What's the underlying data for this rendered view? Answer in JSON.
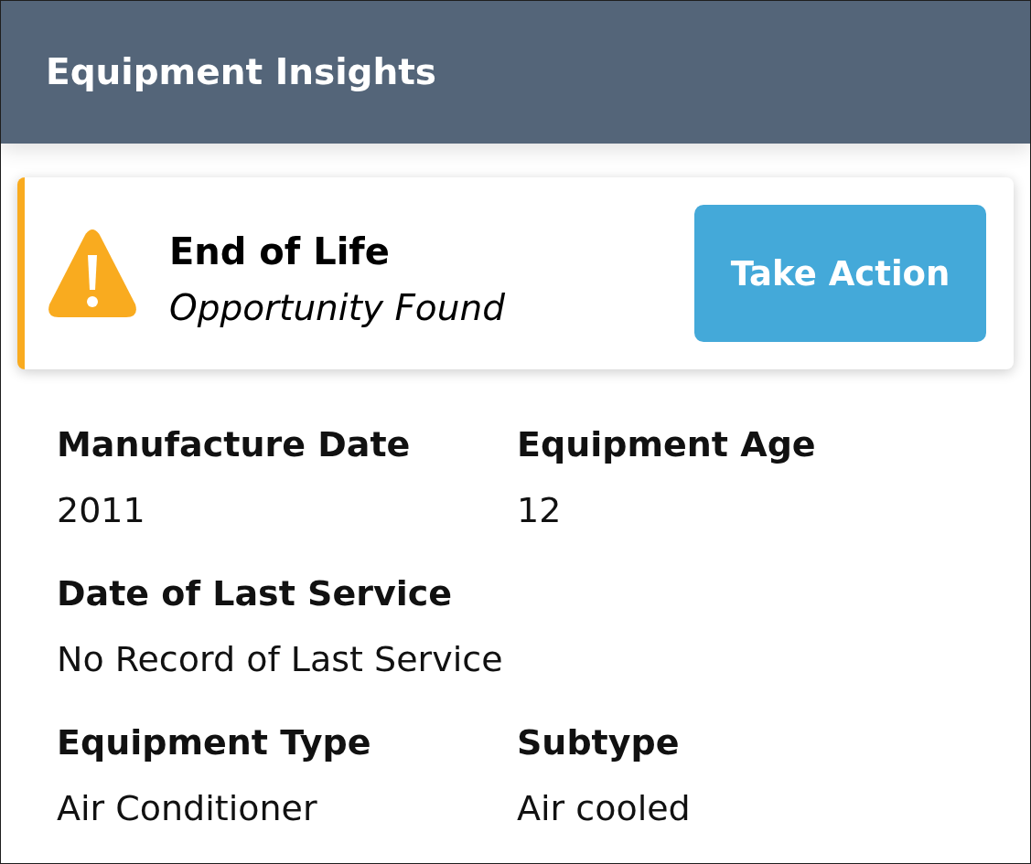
{
  "header": {
    "title": "Equipment Insights"
  },
  "alert": {
    "title": "End of Life",
    "subtitle": "Opportunity Found",
    "action": {
      "label": "Take Action"
    }
  },
  "rows": [
    {
      "fields": [
        {
          "label": "Manufacture Date",
          "value": "2011"
        },
        {
          "label": "Equipment Age",
          "value": "12"
        }
      ]
    },
    {
      "fields": [
        {
          "label": "Date of Last Service",
          "value": "No Record of Last Service"
        }
      ]
    },
    {
      "fields": [
        {
          "label": "Equipment Type",
          "value": "Air Conditioner"
        },
        {
          "label": "Subtype",
          "value": "Air cooled"
        }
      ]
    }
  ]
}
